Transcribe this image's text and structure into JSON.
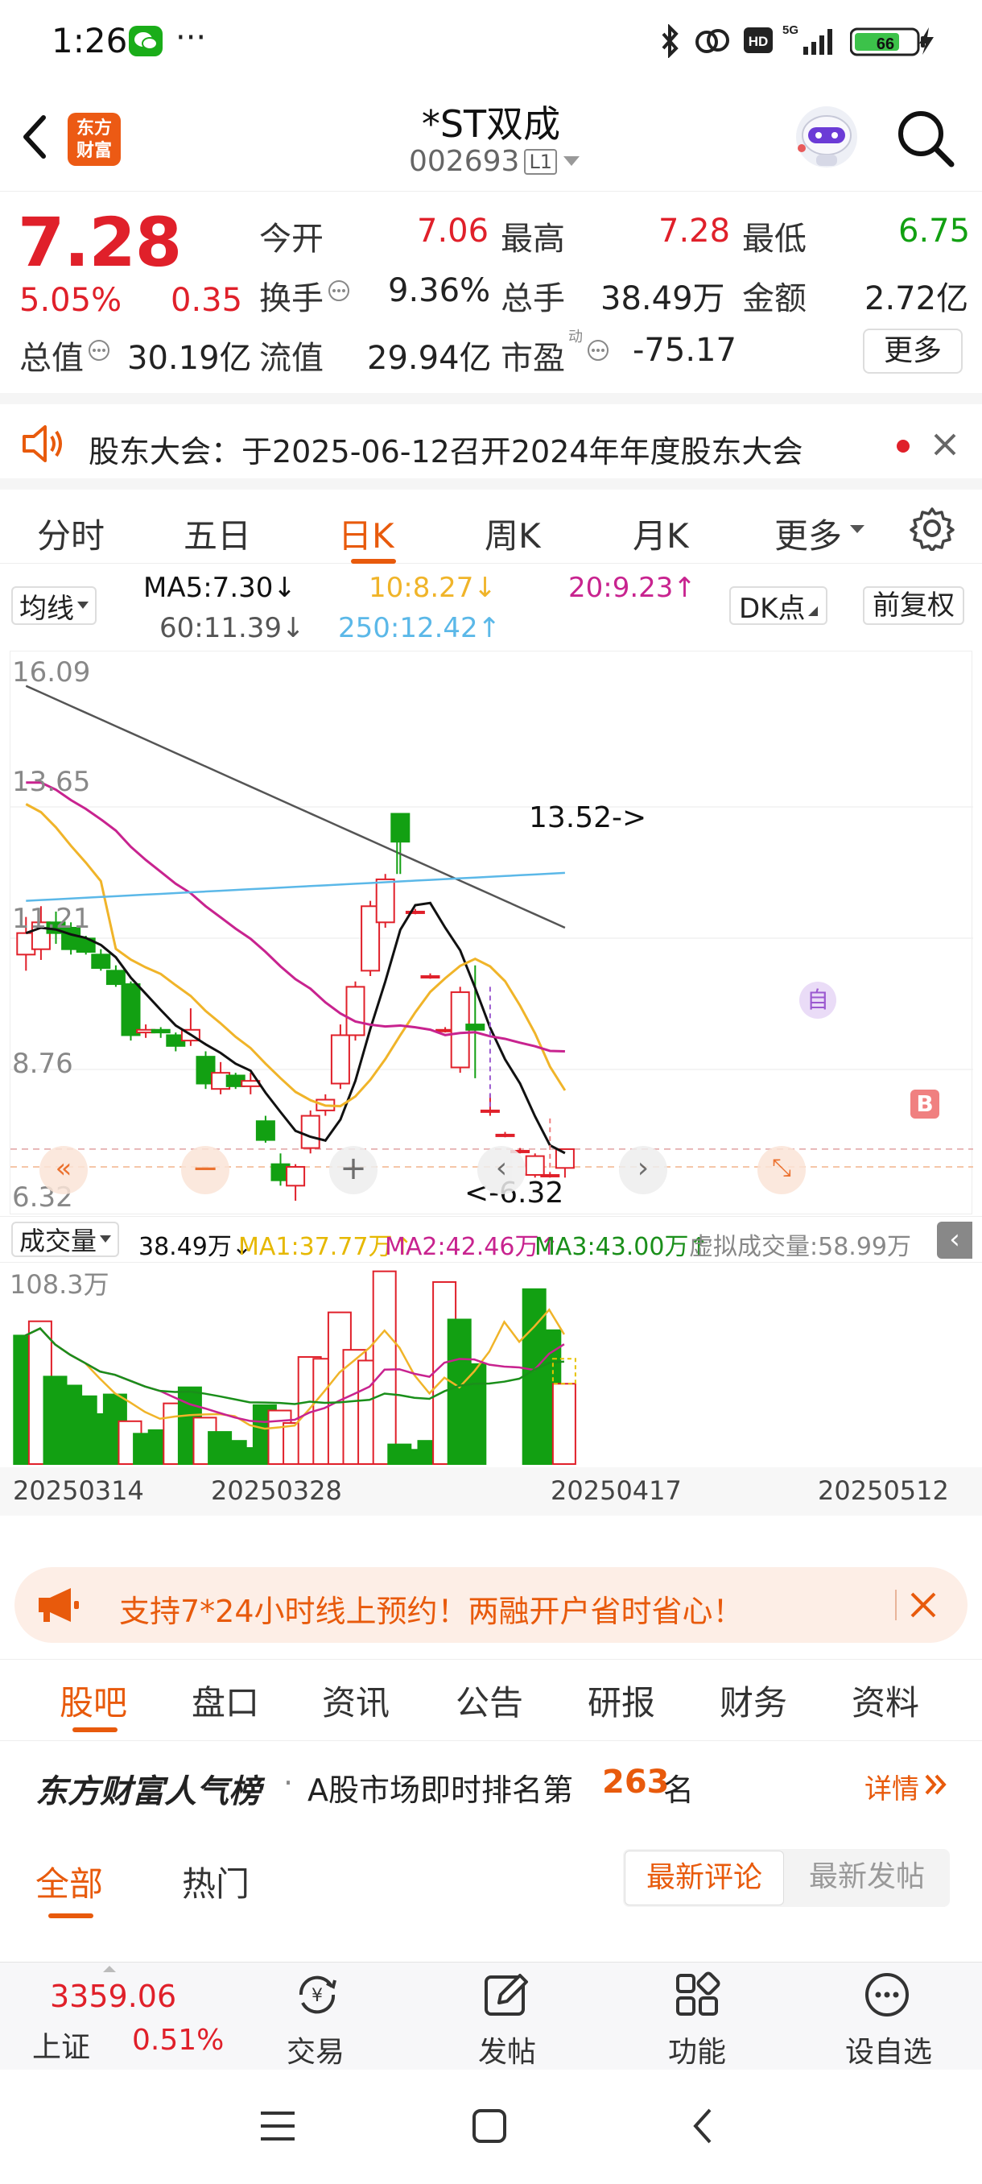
{
  "status_bar": {
    "time": "1:26",
    "more": "···",
    "battery": "66"
  },
  "header": {
    "logo_line1": "东方",
    "logo_line2": "财富",
    "title": "*ST双成",
    "code": "002693",
    "level": "L1"
  },
  "quote": {
    "price": "7.28",
    "change_pct": "5.05%",
    "change": "0.35",
    "open_label": "今开",
    "open": "7.06",
    "high_label": "最高",
    "high": "7.28",
    "low_label": "最低",
    "low": "6.75",
    "turnover_label": "换手",
    "turnover": "9.36%",
    "volume_label": "总手",
    "volume": "38.49万",
    "amount_label": "金额",
    "amount": "2.72亿",
    "mktcap_label": "总值",
    "mktcap": "30.19亿",
    "float_label": "流值",
    "float": "29.94亿",
    "pe_label": "市盈",
    "pe_sup": "动",
    "pe": "-75.17",
    "more_button": "更多"
  },
  "notice": {
    "text": "股东大会：于2025-06-12召开2024年年度股东大会"
  },
  "chart_tabs": [
    "分时",
    "五日",
    "日K",
    "周K",
    "月K",
    "更多"
  ],
  "active_chart_tab": "日K",
  "ma_bar": {
    "selector": "均线",
    "ma5": "MA5:7.30↓",
    "ma10": "10:8.27↓",
    "ma20": "20:9.23↑",
    "ma60": "60:11.39↓",
    "ma250": "250:12.42↑",
    "dk_button": "DK点",
    "adjust_button": "前复权"
  },
  "colors": {
    "up": "#e0202a",
    "down": "#12a012",
    "ma5": "#111111",
    "ma10": "#f0b429",
    "ma20": "#c8238f",
    "ma60": "#555555",
    "ma250": "#5bb8e8",
    "accent": "#e85a0c"
  },
  "chart_data": [
    {
      "type": "candlestick",
      "y_labels": [
        "16.09",
        "13.65",
        "11.21",
        "8.76",
        "6.32"
      ],
      "ylim": [
        6.32,
        16.09
      ],
      "annotations": [
        "13.52->",
        "<-6.32"
      ],
      "markers": [
        "自",
        "B"
      ],
      "candles": [
        {
          "o": 10.9,
          "h": 11.6,
          "l": 10.6,
          "c": 11.3
        },
        {
          "o": 11.0,
          "h": 11.8,
          "l": 10.8,
          "c": 11.5
        },
        {
          "o": 11.5,
          "h": 11.7,
          "l": 11.1,
          "c": 11.3
        },
        {
          "o": 11.4,
          "h": 11.5,
          "l": 10.9,
          "c": 11.0
        },
        {
          "o": 11.2,
          "h": 11.25,
          "l": 10.9,
          "c": 10.95
        },
        {
          "o": 10.9,
          "h": 11.0,
          "l": 10.6,
          "c": 10.65
        },
        {
          "o": 10.6,
          "h": 10.7,
          "l": 10.3,
          "c": 10.35
        },
        {
          "o": 10.35,
          "h": 10.4,
          "l": 9.3,
          "c": 9.4
        },
        {
          "o": 9.45,
          "h": 9.6,
          "l": 9.35,
          "c": 9.5
        },
        {
          "o": 9.5,
          "h": 9.55,
          "l": 9.35,
          "c": 9.45
        },
        {
          "o": 9.4,
          "h": 9.45,
          "l": 9.1,
          "c": 9.2
        },
        {
          "o": 9.3,
          "h": 9.9,
          "l": 9.2,
          "c": 9.5
        },
        {
          "o": 9.0,
          "h": 9.1,
          "l": 8.4,
          "c": 8.5
        },
        {
          "o": 8.4,
          "h": 8.9,
          "l": 8.3,
          "c": 8.7
        },
        {
          "o": 8.65,
          "h": 8.7,
          "l": 8.4,
          "c": 8.45
        },
        {
          "o": 8.45,
          "h": 8.7,
          "l": 8.3,
          "c": 8.55
        },
        {
          "o": 7.8,
          "h": 7.9,
          "l": 7.4,
          "c": 7.45
        },
        {
          "o": 7.0,
          "h": 7.2,
          "l": 6.6,
          "c": 6.7
        },
        {
          "o": 6.6,
          "h": 7.0,
          "l": 6.32,
          "c": 6.95
        },
        {
          "o": 7.3,
          "h": 8.0,
          "l": 7.2,
          "c": 7.9
        },
        {
          "o": 8.0,
          "h": 8.3,
          "l": 7.9,
          "c": 8.2
        },
        {
          "o": 8.5,
          "h": 9.6,
          "l": 8.4,
          "c": 9.4
        },
        {
          "o": 9.4,
          "h": 10.4,
          "l": 9.3,
          "c": 10.3
        },
        {
          "o": 10.6,
          "h": 11.9,
          "l": 10.5,
          "c": 11.8
        },
        {
          "o": 11.5,
          "h": 12.4,
          "l": 11.4,
          "c": 12.3
        },
        {
          "o": 13.52,
          "h": 13.52,
          "l": 12.4,
          "c": 13.0
        },
        {
          "o": 11.7,
          "h": 11.75,
          "l": 11.65,
          "c": 11.7
        },
        {
          "o": 10.5,
          "h": 10.55,
          "l": 10.45,
          "c": 10.5
        },
        {
          "o": 9.5,
          "h": 9.55,
          "l": 9.45,
          "c": 9.5
        },
        {
          "o": 8.8,
          "h": 10.3,
          "l": 8.7,
          "c": 10.2
        },
        {
          "o": 9.6,
          "h": 10.7,
          "l": 8.6,
          "c": 9.5
        },
        {
          "o": 8.0,
          "h": 8.3,
          "l": 7.9,
          "c": 8.0
        },
        {
          "o": 7.55,
          "h": 7.6,
          "l": 7.5,
          "c": 7.55
        },
        {
          "o": 7.25,
          "h": 7.3,
          "l": 7.2,
          "c": 7.25
        },
        {
          "o": 6.8,
          "h": 7.2,
          "l": 6.75,
          "c": 7.15
        },
        {
          "o": 6.8,
          "h": 6.85,
          "l": 6.75,
          "c": 6.8
        },
        {
          "o": 6.93,
          "h": 7.28,
          "l": 6.75,
          "c": 7.28
        }
      ]
    },
    {
      "type": "bar",
      "title": "成交量",
      "max_label": "108.3万",
      "x_labels": [
        "20250314",
        "20250328",
        "20250417",
        "20250512"
      ],
      "legend": {
        "total": "38.49万↓",
        "ma1": "MA1:37.77万↑",
        "ma2": "MA2:42.46万↑",
        "ma3": "MA3:43.00万↑",
        "virtual": "虚拟成交量:58.99万"
      },
      "volumes": [
        {
          "v": 72,
          "up": false
        },
        {
          "v": 80,
          "up": true
        },
        {
          "v": 49,
          "up": false
        },
        {
          "v": 44,
          "up": false
        },
        {
          "v": 38,
          "up": false
        },
        {
          "v": 28,
          "up": false
        },
        {
          "v": 39,
          "up": false
        },
        {
          "v": 24,
          "up": true
        },
        {
          "v": 17,
          "up": false
        },
        {
          "v": 19,
          "up": false
        },
        {
          "v": 34,
          "up": true
        },
        {
          "v": 43,
          "up": false
        },
        {
          "v": 26,
          "up": true
        },
        {
          "v": 18,
          "up": false
        },
        {
          "v": 13,
          "up": false
        },
        {
          "v": 9,
          "up": false
        },
        {
          "v": 33,
          "up": false
        },
        {
          "v": 30,
          "up": true
        },
        {
          "v": 23,
          "up": true
        },
        {
          "v": 60,
          "up": true
        },
        {
          "v": 59,
          "up": true
        },
        {
          "v": 85,
          "up": true
        },
        {
          "v": 64,
          "up": true
        },
        {
          "v": 58,
          "up": true
        },
        {
          "v": 108,
          "up": true
        },
        {
          "v": 11,
          "up": false
        },
        {
          "v": 8,
          "up": false
        },
        {
          "v": 13,
          "up": false
        },
        {
          "v": 102,
          "up": true
        },
        {
          "v": 81,
          "up": false
        },
        {
          "v": 56,
          "up": false
        },
        {
          "v": 0,
          "up": false
        },
        {
          "v": 0,
          "up": false
        },
        {
          "v": 0,
          "up": false
        },
        {
          "v": 98,
          "up": false
        },
        {
          "v": 75,
          "up": false
        },
        {
          "v": 45,
          "up": true
        }
      ]
    }
  ],
  "ad": {
    "text": "支持7*24小时线上预约！两融开户省时省心！"
  },
  "section_tabs": [
    "股吧",
    "盘口",
    "资讯",
    "公告",
    "研报",
    "财务",
    "资料"
  ],
  "active_section_tab": "股吧",
  "rank": {
    "brand": "东方财富人气榜",
    "sep": "·",
    "prefix": "A股市场即时排名第",
    "number": "263",
    "suffix": "名",
    "detail": "详情"
  },
  "filter_tabs": {
    "all": "全部",
    "hot": "热门",
    "latest_comment": "最新评论",
    "latest_post": "最新发帖"
  },
  "bottom_bar": {
    "index_value": "3359.06",
    "index_name": "上证",
    "index_change": "0.51%",
    "trade": "交易",
    "post": "发帖",
    "function": "功能",
    "watchlist": "设自选"
  }
}
